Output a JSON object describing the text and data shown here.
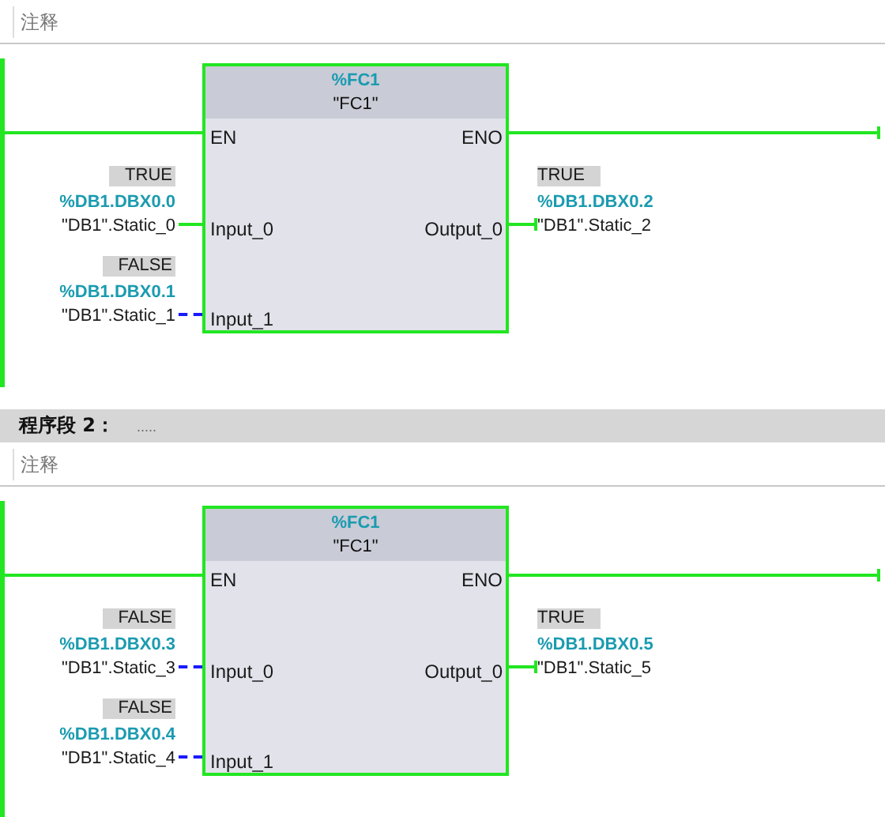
{
  "networks": [
    {
      "comment": {
        "placeholder": "注释"
      },
      "powered": true,
      "block": {
        "address": "%FC1",
        "name": "\"FC1\"",
        "en": "EN",
        "eno": "ENO"
      },
      "inputs": [
        {
          "pin": "Input_0",
          "value": "TRUE",
          "address": "%DB1.DBX0.0",
          "symbol": "\"DB1\".Static_0",
          "energized": true
        },
        {
          "pin": "Input_1",
          "value": "FALSE",
          "address": "%DB1.DBX0.1",
          "symbol": "\"DB1\".Static_1",
          "energized": false
        }
      ],
      "outputs": [
        {
          "pin": "Output_0",
          "value": "TRUE",
          "address": "%DB1.DBX0.2",
          "symbol": "\"DB1\".Static_2",
          "energized": true
        }
      ]
    },
    {
      "header": {
        "title": "程序段 2：",
        "text": "....."
      },
      "comment": {
        "placeholder": "注释"
      },
      "powered": true,
      "block": {
        "address": "%FC1",
        "name": "\"FC1\"",
        "en": "EN",
        "eno": "ENO"
      },
      "inputs": [
        {
          "pin": "Input_0",
          "value": "FALSE",
          "address": "%DB1.DBX0.3",
          "symbol": "\"DB1\".Static_3",
          "energized": false
        },
        {
          "pin": "Input_1",
          "value": "FALSE",
          "address": "%DB1.DBX0.4",
          "symbol": "\"DB1\".Static_4",
          "energized": false
        }
      ],
      "outputs": [
        {
          "pin": "Output_0",
          "value": "TRUE",
          "address": "%DB1.DBX0.5",
          "symbol": "\"DB1\".Static_5",
          "energized": true
        }
      ]
    }
  ]
}
